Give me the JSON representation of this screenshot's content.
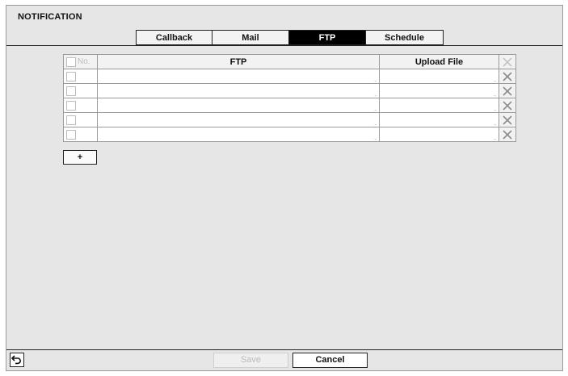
{
  "page": {
    "title": "NOTIFICATION"
  },
  "tabs": [
    {
      "label": "Callback",
      "active": false
    },
    {
      "label": "Mail",
      "active": false
    },
    {
      "label": "FTP",
      "active": true
    },
    {
      "label": "Schedule",
      "active": false
    }
  ],
  "table": {
    "headers": {
      "no": "No.",
      "ftp": "FTP",
      "upload": "Upload File"
    },
    "rows": [
      {
        "ftp": "",
        "upload": ""
      },
      {
        "ftp": "",
        "upload": ""
      },
      {
        "ftp": "",
        "upload": ""
      },
      {
        "ftp": "",
        "upload": ""
      },
      {
        "ftp": "",
        "upload": ""
      }
    ]
  },
  "buttons": {
    "add": "+",
    "save": "Save",
    "cancel": "Cancel"
  },
  "icons": {
    "back": "back-arrow-icon",
    "delete": "x-icon"
  },
  "colors": {
    "active_tab_bg": "#000000",
    "panel_bg": "#e6e6e6",
    "disabled_text": "#bbbbbb"
  }
}
